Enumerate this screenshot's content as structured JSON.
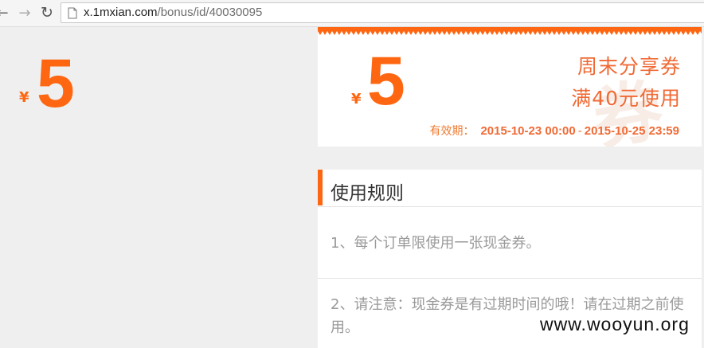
{
  "browser": {
    "back_icon": "back-arrow-icon",
    "forward_icon": "forward-arrow-icon",
    "reload_icon": "reload-icon",
    "url_host": "x.1mxian.com",
    "url_path": "/bonus/id/40030095"
  },
  "left": {
    "currency": "¥",
    "amount": "5"
  },
  "coupon": {
    "currency": "¥",
    "amount": "5",
    "title": "周末分享券",
    "min_spend": "满40元使用",
    "validity_label": "有效期：",
    "start": "2015-10-23 00:00",
    "separator": "-",
    "end": "2015-10-25 23:59",
    "accent_color": "#ff6611"
  },
  "rules": {
    "title": "使用规则",
    "items": [
      "1、每个订单限使用一张现金券。",
      "2、请注意：现金券是有过期时间的哦！请在过期之前使用。"
    ]
  },
  "watermark": "www.wooyun.org"
}
